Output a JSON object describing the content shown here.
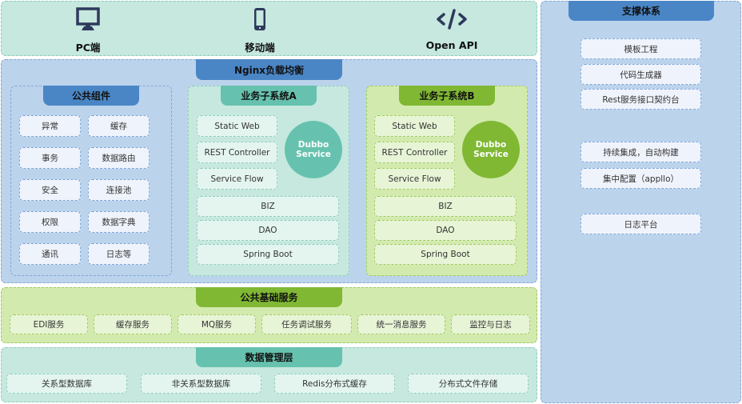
{
  "clients": [
    {
      "label": "PC端",
      "icon": "desktop-monitor-icon"
    },
    {
      "label": "移动端",
      "icon": "mobile-phone-icon"
    },
    {
      "label": "Open API",
      "icon": "code-brackets-icon"
    }
  ],
  "gateway": {
    "title": "Nginx负载均衡"
  },
  "common_components": {
    "title": "公共组件",
    "items": [
      "异常",
      "缓存",
      "事务",
      "数据路由",
      "安全",
      "连接池",
      "权限",
      "数据字典",
      "通讯",
      "日志等"
    ]
  },
  "subsystems": [
    {
      "title": "业务子系统A",
      "web_layers": [
        "Static Web",
        "REST Controller",
        "Service Flow"
      ],
      "service": [
        "Dubbo",
        "Service"
      ],
      "layers": [
        "BIZ",
        "DAO",
        "Spring Boot"
      ]
    },
    {
      "title": "业务子系统B",
      "web_layers": [
        "Static Web",
        "REST Controller",
        "Service Flow"
      ],
      "service": [
        "Dubbo",
        "Service"
      ],
      "layers": [
        "BIZ",
        "DAO",
        "Spring Boot"
      ]
    }
  ],
  "base_services": {
    "title": "公共基础服务",
    "items": [
      "EDI服务",
      "缓存服务",
      "MQ服务",
      "任务调试服务",
      "统一消息服务",
      "监控与日志"
    ]
  },
  "data_layer": {
    "title": "数据管理层",
    "items": [
      "关系型数据库",
      "非关系型数据库",
      "Redis分布式缓存",
      "分布式文件存储"
    ]
  },
  "support_system": {
    "title": "支撑体系",
    "items": [
      "模板工程",
      "代码生成器",
      "Rest服务接口契约台",
      "持续集成，自动构建",
      "集中配置（appllo）",
      "日志平台"
    ]
  },
  "colors": {
    "blue": "#4a86c6",
    "teal": "#66c2ae",
    "green": "#80b834",
    "icon": "#2e3a5c"
  }
}
